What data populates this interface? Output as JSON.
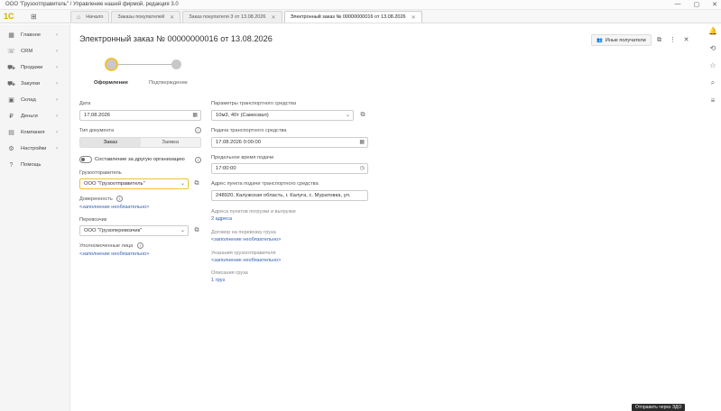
{
  "window": {
    "title": "ООО \"Грузоотправитель\" / Управление нашей фирмой, редакция 3.0"
  },
  "app": {
    "logo": "1С"
  },
  "tabs": [
    {
      "label": "Начало"
    },
    {
      "label": "Заказы покупателей"
    },
    {
      "label": "Заказ покупателя 3 от 13.08.2026"
    },
    {
      "label": "Электронный заказ № 00000000016 от 13.08.2026"
    }
  ],
  "sidebar": {
    "items": [
      {
        "label": "Главное",
        "icon": "grid-icon"
      },
      {
        "label": "CRM",
        "icon": "crm-icon"
      },
      {
        "label": "Продажи",
        "icon": "cart-icon"
      },
      {
        "label": "Закупки",
        "icon": "truck-icon"
      },
      {
        "label": "Склад",
        "icon": "box-icon"
      },
      {
        "label": "Деньги",
        "icon": "money-icon"
      },
      {
        "label": "Компания",
        "icon": "building-icon"
      },
      {
        "label": "Настройки",
        "icon": "gear-icon"
      },
      {
        "label": "Помощь",
        "icon": "help-icon"
      }
    ]
  },
  "header": {
    "title": "Электронный заказ № 00000000016 от 13.08.2026",
    "recipients_button": "Иные получатели"
  },
  "stepper": {
    "steps": [
      {
        "label": "Оформление",
        "active": true
      },
      {
        "label": "Подтверждение",
        "active": false
      }
    ]
  },
  "form": {
    "date_label": "Дата",
    "date_value": "17.08.2026",
    "doc_type_label": "Тип документа",
    "doc_type_options": [
      "Заказ",
      "Заявка"
    ],
    "doc_type_selected": "Заказ",
    "compose_other_org": "Составление за другую организацию",
    "shipper_label": "Грузоотправитель",
    "shipper_value": "ООО \"Грузоотправитель\"",
    "power_of_attorney_label": "Доверенность",
    "power_of_attorney_link": "<заполнение необязательно>",
    "carrier_label": "Перевозчик",
    "carrier_value": "ООО \"Грузоперевозчик\"",
    "authorized_label": "Уполномоченные лица",
    "authorized_link": "<заполнение необязательно>",
    "vehicle_params_label": "Параметры транспортного средства",
    "vehicle_params_value": "10м3, 40т (Самосвал)",
    "vehicle_supply_label": "Подача транспортного средства",
    "vehicle_supply_value": "17.08.2026  0:00:00",
    "deadline_label": "Предельное время подачи",
    "deadline_value": "17:00:00",
    "address_label": "Адрес пункта подачи транспортного средства",
    "address_value": "248920, Калужская область, г. Калуга, с. Муратовка, ул.",
    "loading_addresses_label": "Адреса пунктов погрузки и выгрузки",
    "loading_addresses_link": "2 адреса",
    "contract_label": "Договор на перевозку груза",
    "contract_link": "<заполнение необязательно>",
    "shipper_notes_label": "Указания грузоотправителя",
    "shipper_notes_link": "<заполнение необязательно>",
    "cargo_desc_label": "Описания груза",
    "cargo_desc_link": "1 груз"
  },
  "footer": {
    "send_button": "Отправить через ЭДО"
  }
}
